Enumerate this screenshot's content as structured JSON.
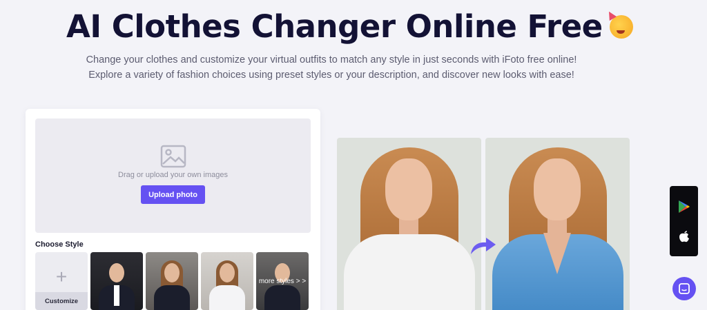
{
  "hero": {
    "title": "AI Clothes Changer Online Free",
    "emoji_icon": "party-face-emoji",
    "subtitle": "Change your clothes and customize your virtual outfits to match any style in just seconds with iFoto free online! Explore a variety of fashion choices using preset styles or your description, and discover new looks with ease!"
  },
  "uploader": {
    "icon": "image-placeholder-icon",
    "drop_text": "Drag or upload your own images",
    "upload_button": "Upload photo"
  },
  "styles": {
    "label": "Choose Style",
    "customize_label": "Customize",
    "more_label": "more styles > >",
    "thumbnails": [
      "man-in-suit",
      "woman-in-blazer",
      "woman-in-white-blouse"
    ]
  },
  "preview": {
    "before": "woman-white-shirt",
    "after": "woman-blue-blazer",
    "arrow_icon": "curved-arrow-right-icon"
  },
  "apps": {
    "google_play_icon": "google-play-icon",
    "apple_icon": "apple-icon"
  },
  "chat": {
    "icon": "chat-icon"
  },
  "colors": {
    "accent": "#6551f2",
    "title": "#131235",
    "background": "#f3f3f8"
  }
}
